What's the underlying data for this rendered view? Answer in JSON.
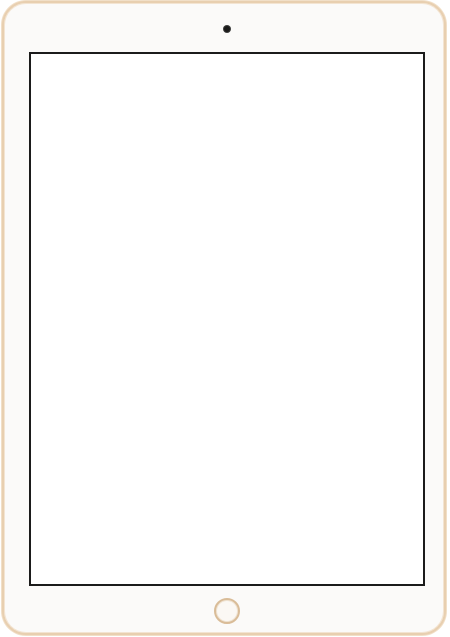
{
  "device": {
    "type": "tablet",
    "finish_color": "#e8cfb0",
    "bezel_color": "#fbfaf9",
    "screen_border_color": "#1b1b1b",
    "screen_color": "#ffffff"
  },
  "icons": {
    "camera": "camera-icon",
    "home_button": "home-button-icon"
  }
}
